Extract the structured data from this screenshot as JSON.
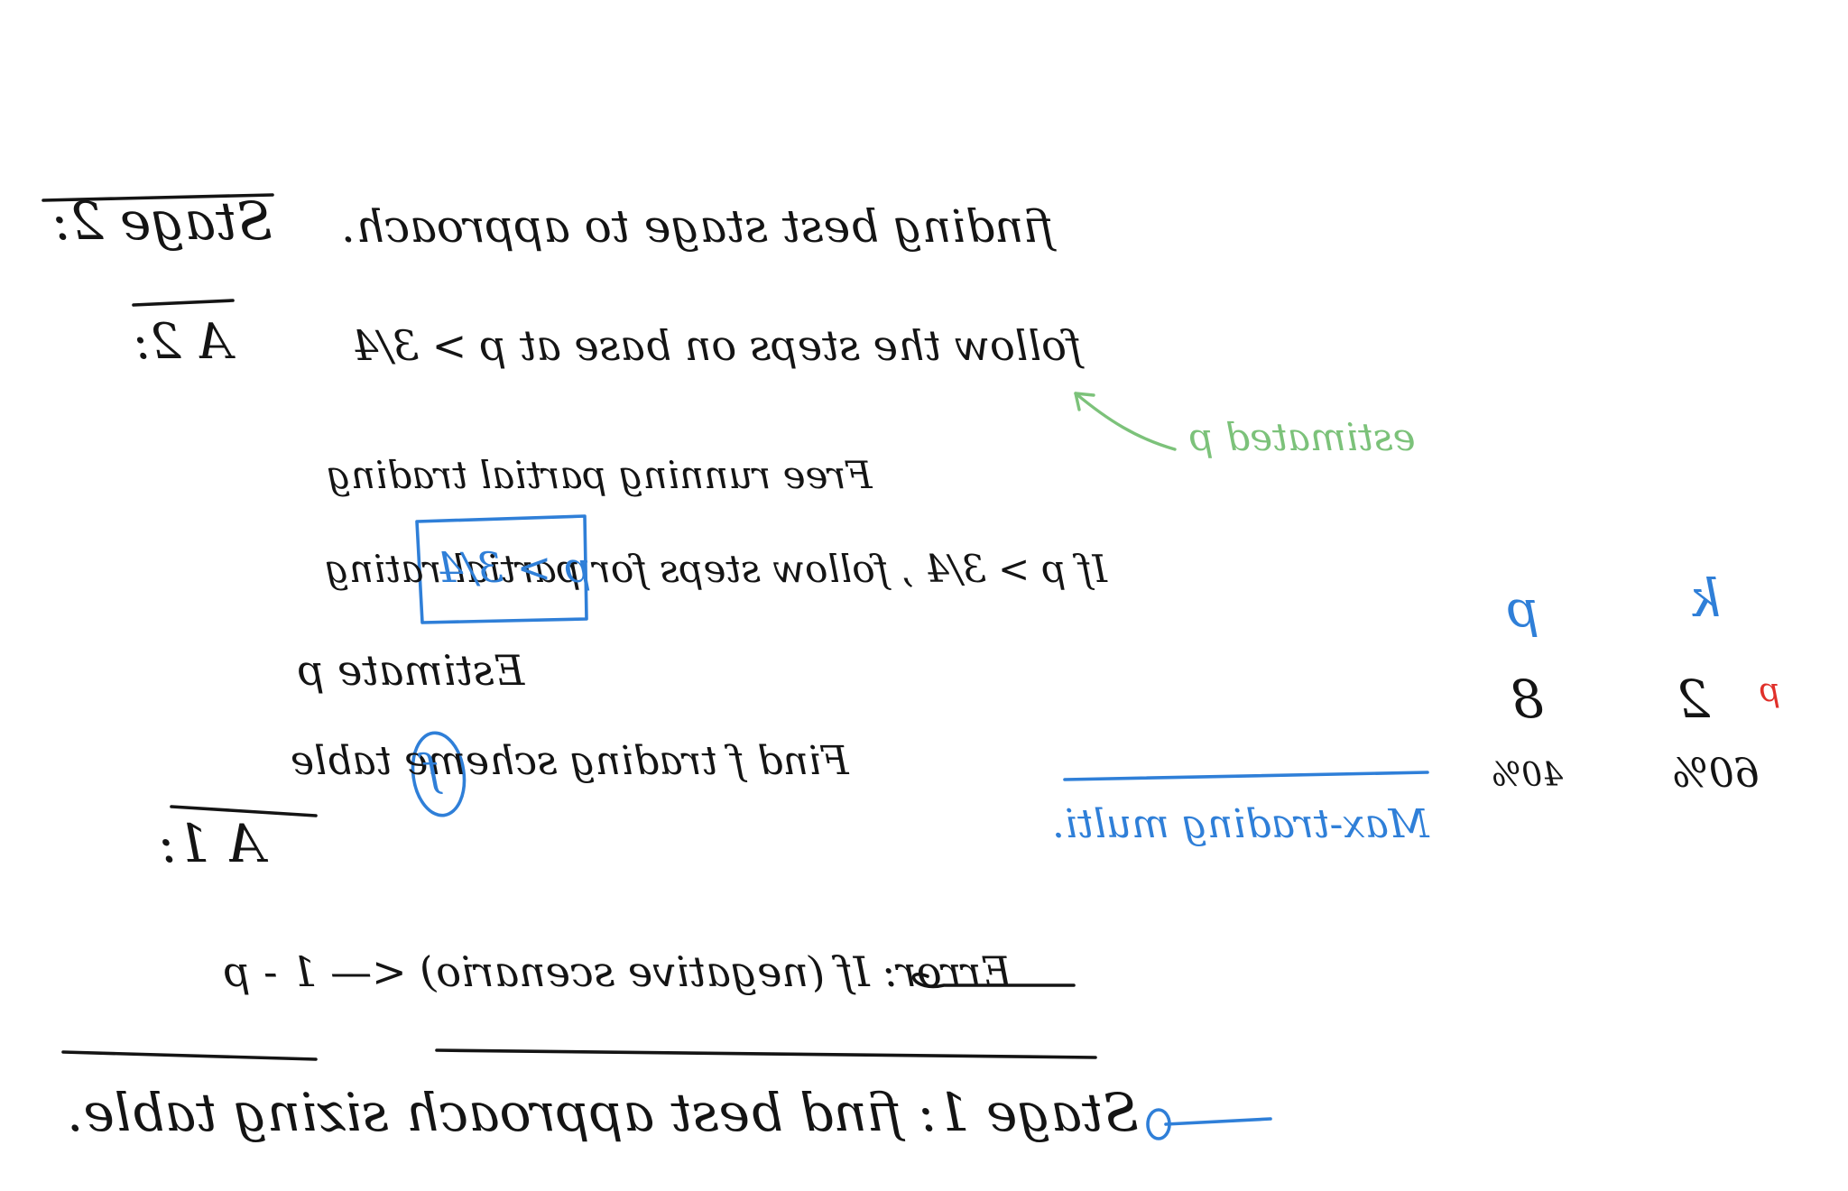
{
  "heading1": {
    "title": "Stage 2:",
    "body": "finding best stage to approach."
  },
  "item2a": {
    "label": "A 2:",
    "body": "follow the steps on base at p > 3/4"
  },
  "estimated_note": {
    "text": "estimated p"
  },
  "bullets": [
    {
      "text": "Free running partial trading"
    },
    {
      "text": "If p > 3/4 , follow steps for partial rating"
    },
    {
      "text": "Estimate p"
    },
    {
      "text": "Find f trading scheme table"
    }
  ],
  "boxed_p": {
    "text": "p > 3/4"
  },
  "circled_f": {
    "text": "f"
  },
  "item1": {
    "label": "A 1:"
  },
  "error_line": {
    "text": "Error: If (negative scenario) <— 1 - p"
  },
  "stage1": {
    "text": "Stage 1: find best approach sizing table."
  },
  "table": {
    "headers": [
      "p",
      "k"
    ],
    "row1": [
      "8",
      "2"
    ],
    "row2": [
      "40%",
      "60%"
    ],
    "red_mark": "p"
  },
  "blue_note": {
    "text": "Max-trading multi."
  },
  "colors": {
    "ink": "#141414",
    "blue": "#2f7fd8",
    "green": "#7cc27a",
    "red": "#e0302a",
    "background": "#ffffff"
  }
}
